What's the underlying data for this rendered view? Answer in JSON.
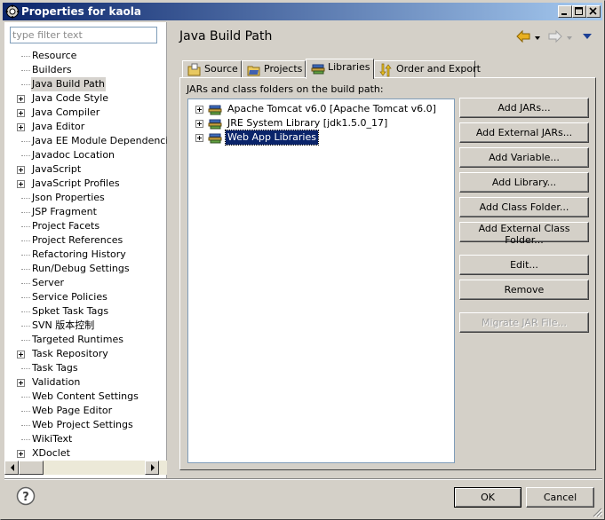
{
  "window": {
    "title": "Properties for kaola"
  },
  "filter": {
    "placeholder": "type filter text"
  },
  "tree": [
    {
      "label": "Resource",
      "expandable": false
    },
    {
      "label": "Builders",
      "expandable": false
    },
    {
      "label": "Java Build Path",
      "expandable": false,
      "selected": true
    },
    {
      "label": "Java Code Style",
      "expandable": true
    },
    {
      "label": "Java Compiler",
      "expandable": true
    },
    {
      "label": "Java Editor",
      "expandable": true
    },
    {
      "label": "Java EE Module Dependencies",
      "expandable": false
    },
    {
      "label": "Javadoc Location",
      "expandable": false
    },
    {
      "label": "JavaScript",
      "expandable": true
    },
    {
      "label": "JavaScript Profiles",
      "expandable": true
    },
    {
      "label": "Json Properties",
      "expandable": false
    },
    {
      "label": "JSP Fragment",
      "expandable": false
    },
    {
      "label": "Project Facets",
      "expandable": false
    },
    {
      "label": "Project References",
      "expandable": false
    },
    {
      "label": "Refactoring History",
      "expandable": false
    },
    {
      "label": "Run/Debug Settings",
      "expandable": false
    },
    {
      "label": "Server",
      "expandable": false
    },
    {
      "label": "Service Policies",
      "expandable": false
    },
    {
      "label": "Spket Task Tags",
      "expandable": false
    },
    {
      "label": "SVN 版本控制",
      "expandable": false
    },
    {
      "label": "Targeted Runtimes",
      "expandable": false
    },
    {
      "label": "Task Repository",
      "expandable": true
    },
    {
      "label": "Task Tags",
      "expandable": false
    },
    {
      "label": "Validation",
      "expandable": true
    },
    {
      "label": "Web Content Settings",
      "expandable": false
    },
    {
      "label": "Web Page Editor",
      "expandable": false
    },
    {
      "label": "Web Project Settings",
      "expandable": false
    },
    {
      "label": "WikiText",
      "expandable": false
    },
    {
      "label": "XDoclet",
      "expandable": true
    }
  ],
  "page": {
    "title": "Java Build Path",
    "tabs": [
      {
        "label": "Source",
        "icon": "source-icon"
      },
      {
        "label": "Projects",
        "icon": "projects-icon"
      },
      {
        "label": "Libraries",
        "icon": "libraries-icon",
        "active": true
      },
      {
        "label": "Order and Export",
        "icon": "order-icon"
      }
    ],
    "list_label": "JARs and class folders on the build path:",
    "libraries": [
      {
        "label": "Apache Tomcat v6.0 [Apache Tomcat v6.0]"
      },
      {
        "label": "JRE System Library [jdk1.5.0_17]"
      },
      {
        "label": "Web App Libraries",
        "selected": true
      }
    ],
    "buttons": {
      "add_jars": "Add JARs...",
      "add_external_jars": "Add External JARs...",
      "add_variable": "Add Variable...",
      "add_library": "Add Library...",
      "add_class_folder": "Add Class Folder...",
      "add_external_class_folder": "Add External Class Folder...",
      "edit": "Edit...",
      "remove": "Remove",
      "migrate_jar": "Migrate JAR File..."
    }
  },
  "footer": {
    "ok": "OK",
    "cancel": "Cancel"
  },
  "colors": {
    "title_start": "#0a246a",
    "title_end": "#a6caf0",
    "selection": "#0a246a",
    "face": "#d4d0c8",
    "nav_arrow": "#e8b020",
    "nav_dropdown": "#1c3f94"
  }
}
